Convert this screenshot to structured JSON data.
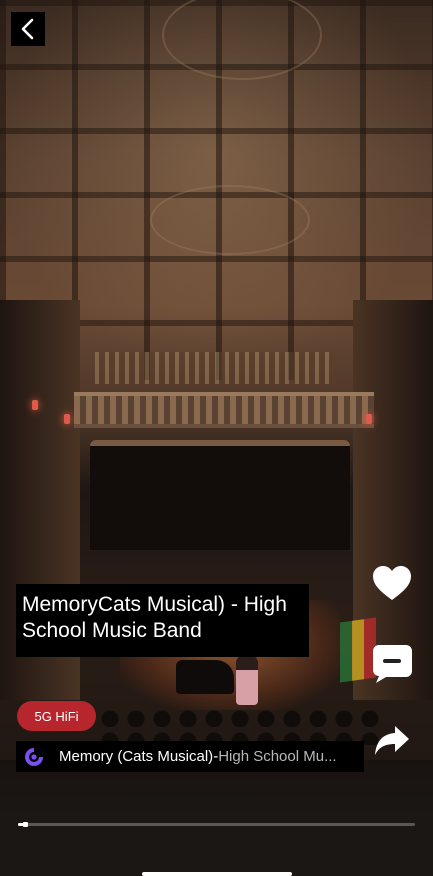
{
  "video": {
    "title": "MemoryCats Musical) - High School Music Band",
    "quality_badge": "5G HiFi",
    "progress_fraction": 0.02
  },
  "music": {
    "song_title": "Memory (Cats Musical)",
    "separator": "-",
    "artist": "High School Mu..."
  },
  "icons": {
    "back": "chevron-left-icon",
    "like": "heart-icon",
    "comment": "comment-icon",
    "share": "share-arrow-icon",
    "music": "music-disc-icon"
  },
  "colors": {
    "badge": "#b7262d",
    "music_icon": "#7b4ff0"
  }
}
